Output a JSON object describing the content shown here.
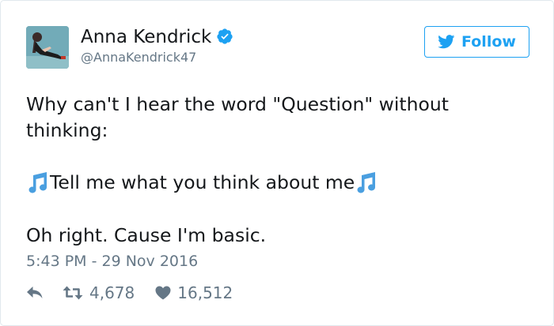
{
  "tweet": {
    "author": {
      "name": "Anna Kendrick",
      "handle": "@AnnaKendrick47",
      "verified": true,
      "avatar_icon": "profile-photo"
    },
    "follow_button": {
      "label": "Follow",
      "icon": "twitter-bird-icon",
      "color": "#1da1f2"
    },
    "text": {
      "line1": "Why can't I hear the word \"Question\" without",
      "line2": "thinking:",
      "line3": "Tell me what you think about me",
      "line3_decoration_icon": "music-note-icon",
      "line4": "Oh right. Cause I'm basic."
    },
    "timestamp": "5:43 PM - 29 Nov 2016",
    "stats": {
      "retweets": "4,678",
      "likes": "16,512"
    },
    "colors": {
      "text": "#14171a",
      "secondary": "#657786",
      "verified": "#1da1f2",
      "note": "#4a9fe0"
    }
  }
}
